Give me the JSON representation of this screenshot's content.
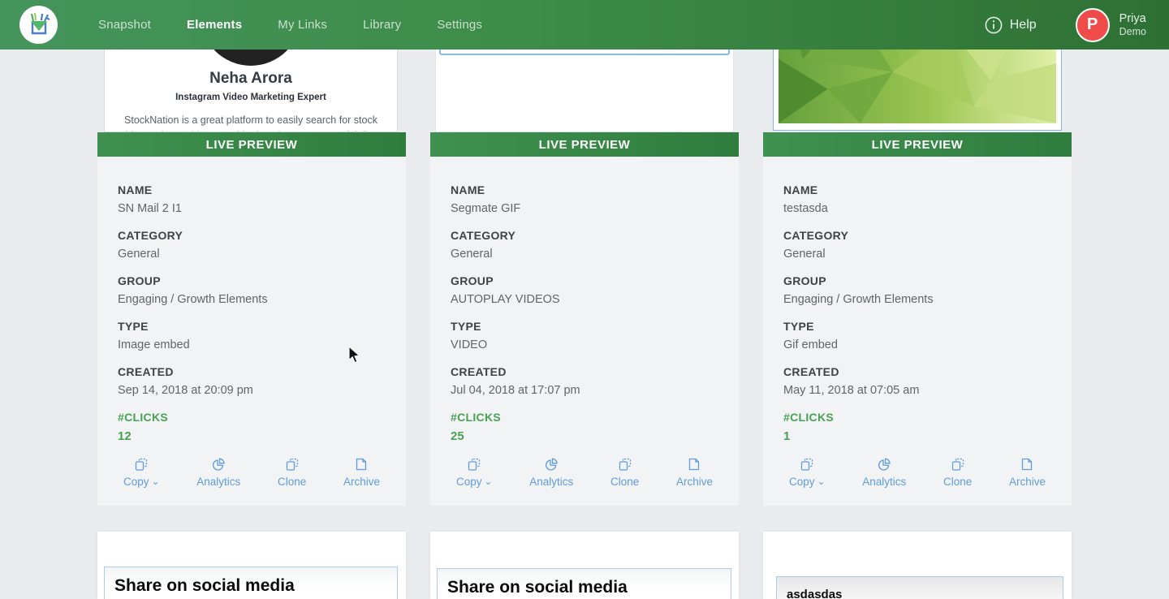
{
  "navbar": {
    "items": [
      {
        "label": "Snapshot",
        "active": false
      },
      {
        "label": "Elements",
        "active": true
      },
      {
        "label": "My Links",
        "active": false
      },
      {
        "label": "Library",
        "active": false
      },
      {
        "label": "Settings",
        "active": false
      }
    ],
    "help_label": "Help",
    "user": {
      "initial": "P",
      "name": "Priya",
      "subtitle": "Demo"
    }
  },
  "field_labels": {
    "name": "NAME",
    "category": "CATEGORY",
    "group": "GROUP",
    "type": "TYPE",
    "created": "CREATED",
    "clicks": "#CLICKS"
  },
  "actions": {
    "copy": "Copy",
    "chevron": "⌄",
    "analytics": "Analytics",
    "clone": "Clone",
    "archive": "Archive"
  },
  "live_preview_label": "LIVE PREVIEW",
  "cards": [
    {
      "preview": {
        "profile_name": "Neha Arora",
        "profile_title": "Instagram Video Marketing Expert",
        "profile_text": "StockNation is a great platform to easily search for stock videos. These videos would otherwise cost 100s of dollars"
      },
      "name": "SN Mail 2 I1",
      "category": "General",
      "group": "Engaging / Growth Elements",
      "type": "Image embed",
      "created": "Sep 14, 2018 at 20:09 pm",
      "clicks": "12"
    },
    {
      "preview": {},
      "name": "Segmate GIF",
      "category": "General",
      "group": "AUTOPLAY VIDEOS",
      "type": "VIDEO",
      "created": "Jul 04, 2018 at 17:07 pm",
      "clicks": "25"
    },
    {
      "preview": {},
      "name": "testasda",
      "category": "General",
      "group": "Engaging / Growth Elements",
      "type": "Gif embed",
      "created": "May 11, 2018 at 07:05 am",
      "clicks": "1"
    }
  ],
  "bottom_cards": [
    {
      "text": "Share on social media"
    },
    {
      "text": "Share on social media"
    },
    {
      "text": "asdasdas"
    }
  ],
  "colors": {
    "navbar_green": "#3e8c48",
    "preview_bar_green": "#378744",
    "action_blue": "#5f9cd9",
    "clicks_green": "#47a254",
    "avatar_red": "#ef4b4b"
  }
}
